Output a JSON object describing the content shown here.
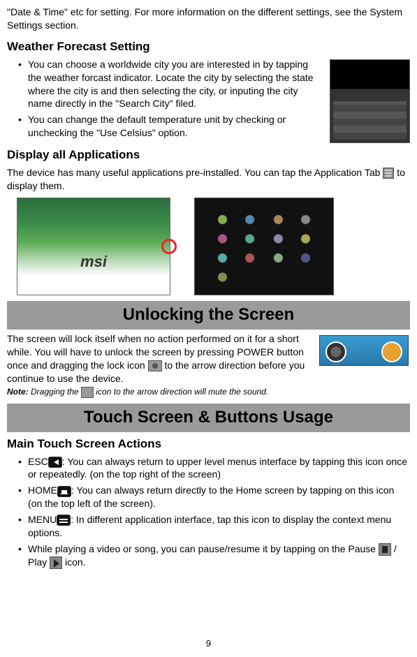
{
  "intro": "\"Date & Time\" etc for setting. For more information on the different settings, see the System Settings section.",
  "weather": {
    "heading": "Weather Forecast Setting",
    "bullets": [
      "You can choose a worldwide city you are interested in by tapping the weather forcast indicator. Locate the city by selecting the state where the city is and then selecting the city, or inputing the city name directly in the \"Search City\" filed.",
      "You can change the default temperature unit by checking or unchecking the \"Use Celsius\" option."
    ]
  },
  "display_apps": {
    "heading": "Display all Applications",
    "text_before_icon": "The device has many useful applications pre-installed. You can tap the Application Tab ",
    "text_after_icon": " to display them."
  },
  "unlocking": {
    "banner": "Unlocking the Screen",
    "text_1": "The screen will lock itself when no action performed on it for a short while. You will have to unlock the screen by pressing POWER button once and dragging the lock icon ",
    "text_2": " to the arrow direction before you continue to use the device.",
    "note_label": "Note:",
    "note_before": " Dragging the ",
    "note_after": " icon to the arrow direction will mute the sound."
  },
  "touch": {
    "banner": "Touch Screen & Buttons Usage",
    "heading": "Main Touch Screen Actions",
    "esc_label": "ESC",
    "esc_text": ": You can always return to upper level menus interface by tapping this icon once or repeatedly. (on the top right of the screen)",
    "home_label": "HOME",
    "home_text": ": You can always return directly to the Home screen by tapping on this icon (on the top left of the screen).",
    "menu_label": "MENU",
    "menu_text": ": In different application interface, tap this icon to display the context menu options.",
    "play_before": "While playing a video or song, you can pause/resume it by tapping on the Pause ",
    "play_mid": " / Play ",
    "play_after": " icon."
  },
  "page_number": "9"
}
